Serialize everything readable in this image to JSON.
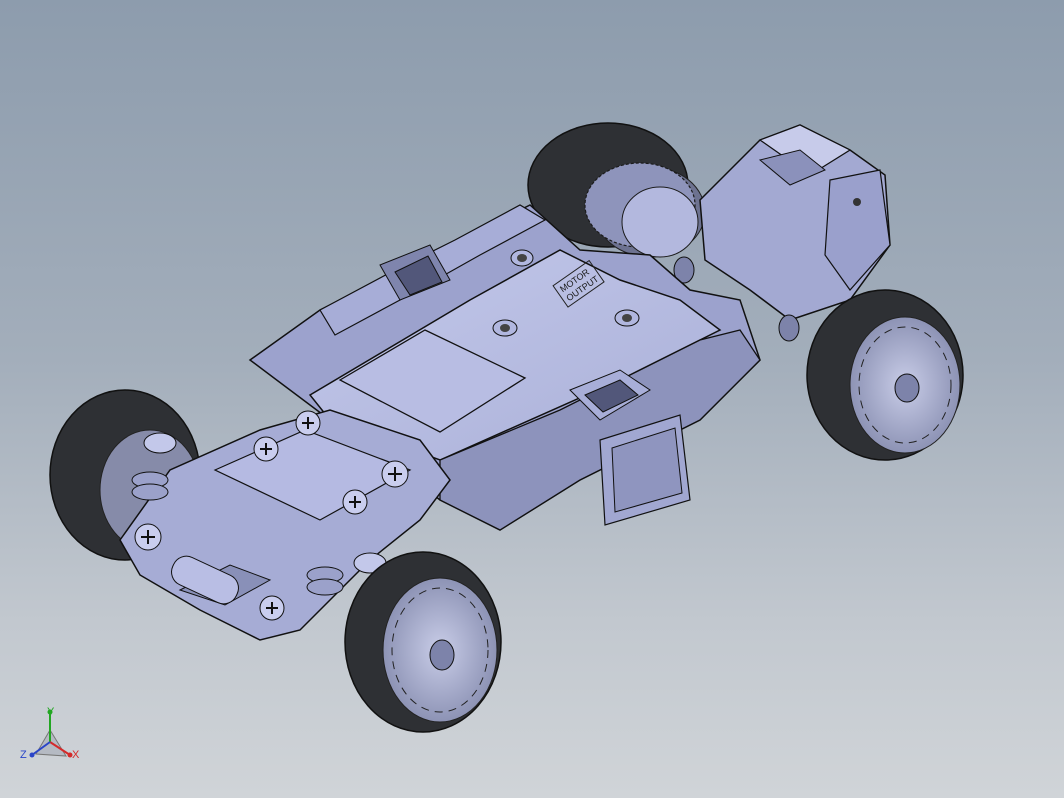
{
  "viewport": {
    "background_top": "#8d9cad",
    "background_bottom": "#d0d4d8",
    "model_color": "#a9b0d6",
    "tire_color": "#303236"
  },
  "model": {
    "battery_marking_1": "MOTOR",
    "battery_marking_2": "OUTPUT"
  },
  "triad": {
    "x_label": "X",
    "y_label": "Y",
    "z_label": "Z",
    "x_color": "#d42a2a",
    "y_color": "#22a622",
    "z_color": "#2a45c8"
  }
}
